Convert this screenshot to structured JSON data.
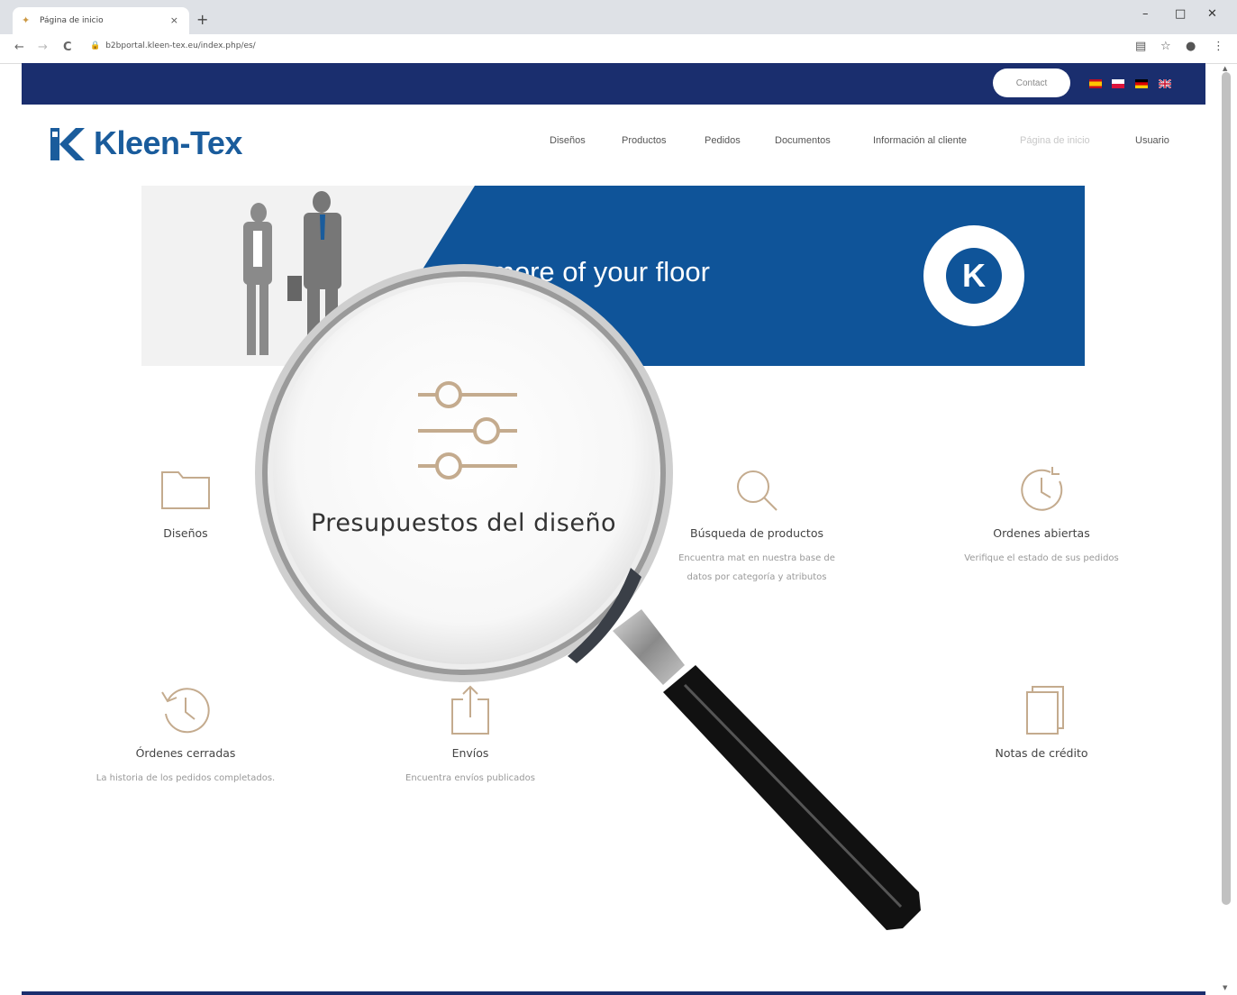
{
  "browser": {
    "tab_title": "Página de inicio",
    "tab_close": "×",
    "new_tab": "+",
    "url": "b2bportal.kleen-tex.eu/index.php/es/",
    "minimize": "–",
    "maximize": "□",
    "close": "✕",
    "back": "←",
    "forward": "→",
    "reload": "C"
  },
  "header": {
    "contact_label": "Contact",
    "languages": [
      "es",
      "pl",
      "de",
      "en"
    ],
    "logo_text": "Kleen-Tex"
  },
  "nav": {
    "items": [
      "Diseños",
      "Productos",
      "Pedidos",
      "Documentos",
      "Información al cliente",
      "Página de inicio",
      "Usuario"
    ],
    "active": "Página de inicio"
  },
  "banner": {
    "text": "more of your floor",
    "badge_letter": "K"
  },
  "cards": [
    {
      "title": "Diseños",
      "desc": "",
      "icon": "folder-icon"
    },
    {
      "title": "Búsqueda de productos",
      "desc": "Encuentra mat en nuestra base de datos por categoría y atributos",
      "icon": "search-icon"
    },
    {
      "title": "Ordenes abiertas",
      "desc": "Verifique el estado de sus pedidos",
      "icon": "clock-icon"
    },
    {
      "title": "Órdenes cerradas",
      "desc": "La historia de los pedidos completados.",
      "icon": "history-icon"
    },
    {
      "title": "Envíos",
      "desc": "Encuentra envíos publicados",
      "icon": "share-icon"
    },
    {
      "title": "Notas de crédito",
      "desc": "",
      "icon": "documents-icon"
    }
  ],
  "magnified": {
    "label": "Presupuestos del diseño",
    "icon": "sliders-icon"
  },
  "colors": {
    "navy": "#1a2e6e",
    "banner_blue": "#0f5499",
    "icon_tan": "#c4ab8e",
    "logo_blue": "#1a5c9c"
  }
}
